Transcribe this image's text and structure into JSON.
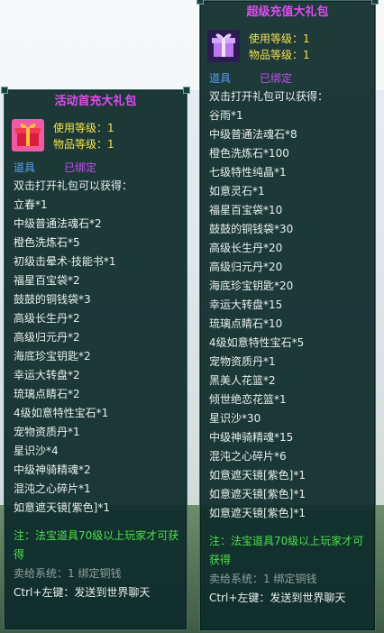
{
  "left": {
    "title": "活动首充大礼包",
    "use_level": "使用等级：1",
    "item_level": "物品等级：1",
    "tag_item": "道具",
    "tag_bound": "已绑定",
    "intro": "双击打开礼包可以获得：",
    "items": [
      "立春*1",
      "中级普通法魂石*2",
      "橙色洗炼石*5",
      "初级击晕术·技能书*1",
      "福星百宝袋*2",
      "鼓鼓的铜钱袋*3",
      "高级长生丹*2",
      "高级归元丹*2",
      "海底珍宝钥匙*2",
      "幸运大转盘*2",
      "琉璃点睛石*2",
      "4级如意特性宝石*1",
      "宠物资质丹*1",
      "星识沙*4",
      "中级神骑精魂*2",
      "混沌之心碎片*1",
      "如意遮天镜[紫色]*1"
    ],
    "note": "注：法宝道具70级以上玩家才可获得",
    "sell": "卖给系统：1 绑定铜钱",
    "ctrl": "Ctrl+左键：发送到世界聊天"
  },
  "right": {
    "title": "超级充值大礼包",
    "use_level": "使用等级：1",
    "item_level": "物品等级：1",
    "tag_item": "道具",
    "tag_bound": "已绑定",
    "intro": "双击打开礼包可以获得：",
    "items": [
      "谷雨*1",
      "中级普通法魂石*8",
      "橙色洗炼石*100",
      "七级特性纯晶*1",
      "如意灵石*1",
      "福星百宝袋*10",
      "鼓鼓的铜钱袋*30",
      "高级长生丹*20",
      "高级归元丹*20",
      "海底珍宝钥匙*20",
      "幸运大转盘*15",
      "琉璃点睛石*10",
      "4级如意特性宝石*5",
      "宠物资质丹*1",
      "黑美人花篮*2",
      "倾世绝恋花篮*1",
      "星识沙*30",
      "中级神骑精魂*15",
      "混沌之心碎片*6",
      "如意遮天镜[紫色]*1",
      "如意遮天镜[紫色]*1",
      "如意遮天镜[紫色]*1"
    ],
    "note": "注：法宝道具70级以上玩家才可获得",
    "sell": "卖给系统：1 绑定铜钱",
    "ctrl": "Ctrl+左键：发送到世界聊天"
  }
}
